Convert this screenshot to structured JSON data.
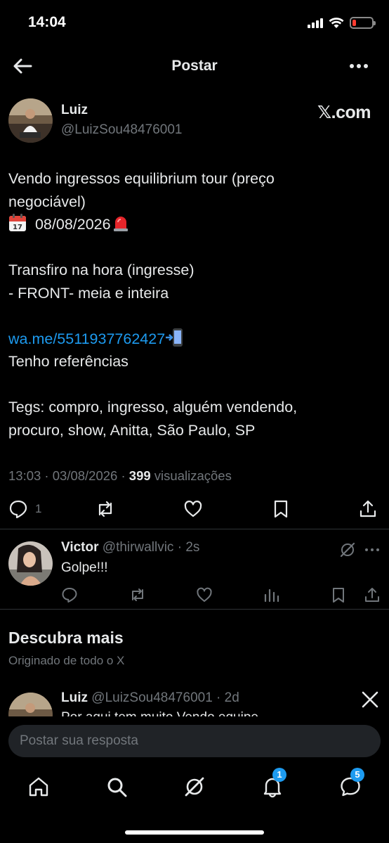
{
  "status_bar": {
    "time": "14:04",
    "battery_color": "#ff3b30"
  },
  "header": {
    "title": "Postar",
    "back_icon": "arrow-left-icon",
    "more_icon": "more-horizontal-icon"
  },
  "post": {
    "author_name": "Luiz",
    "author_handle": "@LuizSou48476001",
    "source": "𝕏.com",
    "lines": [
      "Vendo ingressos equilibrium tour (preço",
      "negociável)",
      " 08/08/2026",
      "",
      "Transfiro na hora (ingresse)",
      "- FRONT- meia e inteira",
      "",
      "wa.me/5511937762427",
      "Tenho referências",
      "",
      "Tegs: compro, ingresso, alguém vendendo,",
      "procuro, show, Anitta, São Paulo, SP"
    ],
    "link_color": "#1d9bf0",
    "meta_time": "13:03 · 03/08/2026 · ",
    "views_count": "399",
    "views_label": " visualizações",
    "reply_count": "1"
  },
  "reply": {
    "name": "Victor",
    "handle": " @thirwallvic · 2s",
    "text": "Golpe!!!"
  },
  "discover": {
    "title": "Descubra mais",
    "subtitle": "Originado de todo o X",
    "name": "Luiz",
    "handle": " @LuizSou48476001 · 2d",
    "clipped_text": "Por aqui tem muito Vendo equipe"
  },
  "composer": {
    "placeholder": "Postar sua resposta"
  },
  "tabbar": {
    "notifications_badge": "1",
    "messages_badge": "5"
  },
  "colors": {
    "background": "#000000",
    "text": "#e7e9ea",
    "muted": "#71767b",
    "accent": "#1d9bf0",
    "divider": "#2f3336"
  }
}
